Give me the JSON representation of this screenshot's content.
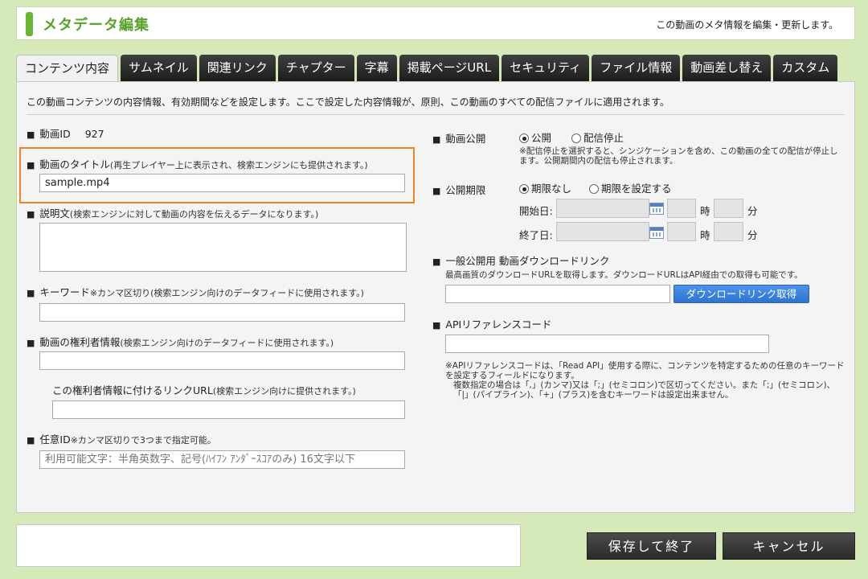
{
  "header": {
    "title": "メタデータ編集",
    "description": "この動画のメタ情報を編集・更新します。"
  },
  "tabs": [
    {
      "label": "コンテンツ内容",
      "active": true
    },
    {
      "label": "サムネイル"
    },
    {
      "label": "関連リンク"
    },
    {
      "label": "チャプター"
    },
    {
      "label": "字幕"
    },
    {
      "label": "掲載ページURL"
    },
    {
      "label": "セキュリティ"
    },
    {
      "label": "ファイル情報"
    },
    {
      "label": "動画差し替え"
    },
    {
      "label": "カスタム"
    }
  ],
  "intro": "この動画コンテンツの内容情報、有効期間などを設定します。ここで設定した内容情報が、原則、この動画のすべての配信ファイルに適用されます。",
  "left": {
    "video_id_label": "動画ID",
    "video_id_value": "927",
    "title_label": "動画のタイトル",
    "title_hint": "(再生プレイヤー上に表示され、検索エンジンにも提供されます。)",
    "title_value": "sample.mp4",
    "description_label": "説明文",
    "description_hint": "(検索エンジンに対して動画の内容を伝えるデータになります。)",
    "description_value": "",
    "keyword_label": "キーワード",
    "keyword_hint": "※カンマ区切り(検索エンジン向けのデータフィードに使用されます。)",
    "keyword_value": "",
    "rights_label": "動画の権利者情報",
    "rights_hint": "(検索エンジン向けのデータフィードに使用されます。)",
    "rights_value": "",
    "rights_url_label": "この権利者情報に付けるリンクURL",
    "rights_url_hint": "(検索エンジン向けに提供されます。)",
    "rights_url_value": "",
    "custom_id_label": "任意ID",
    "custom_id_hint": "※カンマ区切りで3つまで指定可能。",
    "custom_id_placeholder": "利用可能文字：半角英数字、記号(ﾊｲﾌﾝ ｱﾝﾀﾞｰｽｺｱのみ) 16文字以下"
  },
  "right": {
    "publish_label": "動画公開",
    "publish_options": [
      "公開",
      "配信停止"
    ],
    "publish_selected": "公開",
    "publish_note": "※配信停止を選択すると、シンジケーションを含め、この動画の全ての配信が停止します。公開期間内の配信も停止されます。",
    "period_label": "公開期限",
    "period_options": [
      "期限なし",
      "期限を設定する"
    ],
    "period_selected": "期限なし",
    "start_label": "開始日:",
    "end_label": "終了日:",
    "hour_label": "時",
    "minute_label": "分",
    "download_label": "一般公開用 動画ダウンロードリンク",
    "download_note": "最高画質のダウンロードURLを取得します。ダウンロードURLはAPI経由での取得も可能です。",
    "download_button": "ダウンロードリンク取得",
    "download_value": "",
    "api_label": "APIリファレンスコード",
    "api_value": "",
    "api_note_1": "※APIリファレンスコードは、「Read API」使用する際に、コンテンツを特定するための任意のキーワードを設定するフィールドになります。",
    "api_note_2": "複数指定の場合は「,」(カンマ)又は「;」(セミコロン)で区切ってください。また「;」(セミコロン)、「|」(パイプライン)、「+」(プラス)を含むキーワードは設定出来ません。"
  },
  "footer": {
    "save_label": "保存して終了",
    "cancel_label": "キャンセル"
  },
  "colors": {
    "background": "#d6e9b9",
    "accent_green": "#5aa22a",
    "highlight_orange": "#f08322",
    "button_blue": "#2f74d0"
  }
}
